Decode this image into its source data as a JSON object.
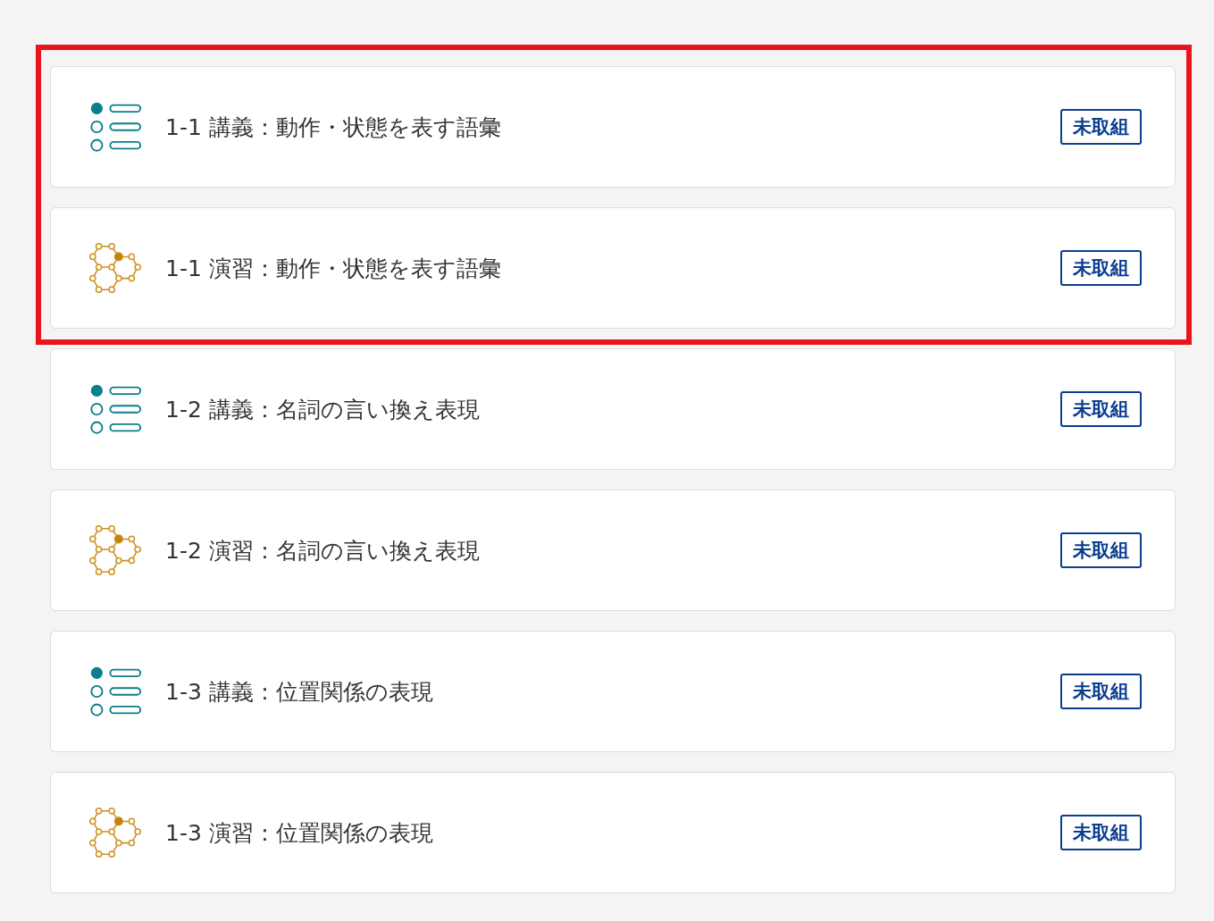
{
  "sections": [
    {
      "highlighted": true,
      "items": [
        {
          "kind": "lecture",
          "title": "1-1 講義：動作・状態を表す語彙",
          "status": "未取組"
        },
        {
          "kind": "exercise",
          "title": "1-1 演習：動作・状態を表す語彙",
          "status": "未取組"
        }
      ]
    },
    {
      "highlighted": false,
      "items": [
        {
          "kind": "lecture",
          "title": "1-2 講義：名詞の言い換え表現",
          "status": "未取組"
        },
        {
          "kind": "exercise",
          "title": "1-2 演習：名詞の言い換え表現",
          "status": "未取組"
        },
        {
          "kind": "lecture",
          "title": "1-3 講義：位置関係の表現",
          "status": "未取組"
        },
        {
          "kind": "exercise",
          "title": "1-3 演習：位置関係の表現",
          "status": "未取組"
        }
      ]
    }
  ]
}
